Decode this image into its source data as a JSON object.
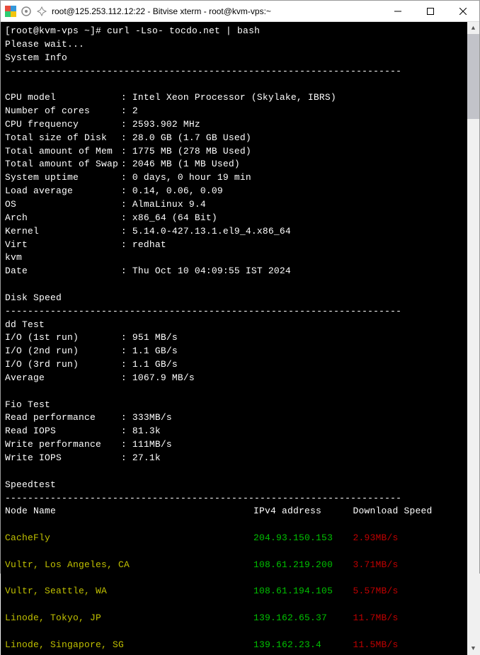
{
  "window": {
    "title": "root@125.253.112.12:22 - Bitvise xterm - root@kvm-vps:~"
  },
  "prompt": "[root@kvm-vps ~]# ",
  "command": "curl -Lso- tocdo.net | bash",
  "wait_msg": "Please wait...",
  "header_sysinfo": "System Info",
  "divider": "----------------------------------------------------------------------",
  "sys": [
    {
      "k": "CPU model",
      "v": "Intel Xeon Processor (Skylake, IBRS)"
    },
    {
      "k": "Number of cores",
      "v": "2"
    },
    {
      "k": "CPU frequency",
      "v": "2593.902 MHz"
    },
    {
      "k": "Total size of Disk",
      "v": "28.0 GB (1.7 GB Used)"
    },
    {
      "k": "Total amount of Mem",
      "v": "1775 MB (278 MB Used)"
    },
    {
      "k": "Total amount of Swap",
      "v": "2046 MB (1 MB Used)"
    },
    {
      "k": "System uptime",
      "v": "0 days, 0 hour 19 min"
    },
    {
      "k": "Load average",
      "v": "0.14, 0.06, 0.09"
    },
    {
      "k": "OS",
      "v": "AlmaLinux 9.4"
    },
    {
      "k": "Arch",
      "v": "x86_64 (64 Bit)"
    },
    {
      "k": "Kernel",
      "v": "5.14.0-427.13.1.el9_4.x86_64"
    },
    {
      "k": "Virt",
      "v": "redhat"
    }
  ],
  "kvm_line": "kvm",
  "date_k": "Date",
  "date_v": "Thu Oct 10 04:09:55 IST 2024",
  "header_disk": "Disk Speed",
  "dd_label": "dd Test",
  "dd": [
    {
      "k": "I/O (1st run)",
      "v": "951 MB/s"
    },
    {
      "k": "I/O (2nd run)",
      "v": "1.1 GB/s"
    },
    {
      "k": "I/O (3rd run)",
      "v": "1.1 GB/s"
    },
    {
      "k": "Average",
      "v": "1067.9 MB/s"
    }
  ],
  "fio_label": "Fio Test",
  "fio": [
    {
      "k": "Read performance",
      "v": "333MB/s"
    },
    {
      "k": "Read IOPS",
      "v": "81.3k"
    },
    {
      "k": "Write performance",
      "v": "111MB/s"
    },
    {
      "k": "Write IOPS",
      "v": "27.1k"
    }
  ],
  "header_speedtest": "Speedtest",
  "sp_header": {
    "c1": "Node Name",
    "c2": "IPv4 address",
    "c3": "Download Speed"
  },
  "sp_rows": [
    {
      "name": "CacheFly",
      "ip": "204.93.150.153",
      "dl": "2.93MB/s"
    },
    {
      "name": "Vultr, Los Angeles, CA",
      "ip": "108.61.219.200",
      "dl": "3.71MB/s"
    },
    {
      "name": "Vultr, Seattle, WA",
      "ip": "108.61.194.105",
      "dl": "5.57MB/s"
    },
    {
      "name": "Linode, Tokyo, JP",
      "ip": "139.162.65.37",
      "dl": "11.7MB/s"
    },
    {
      "name": "Linode, Singapore, SG",
      "ip": "139.162.23.4",
      "dl": "11.5MB/s"
    }
  ]
}
